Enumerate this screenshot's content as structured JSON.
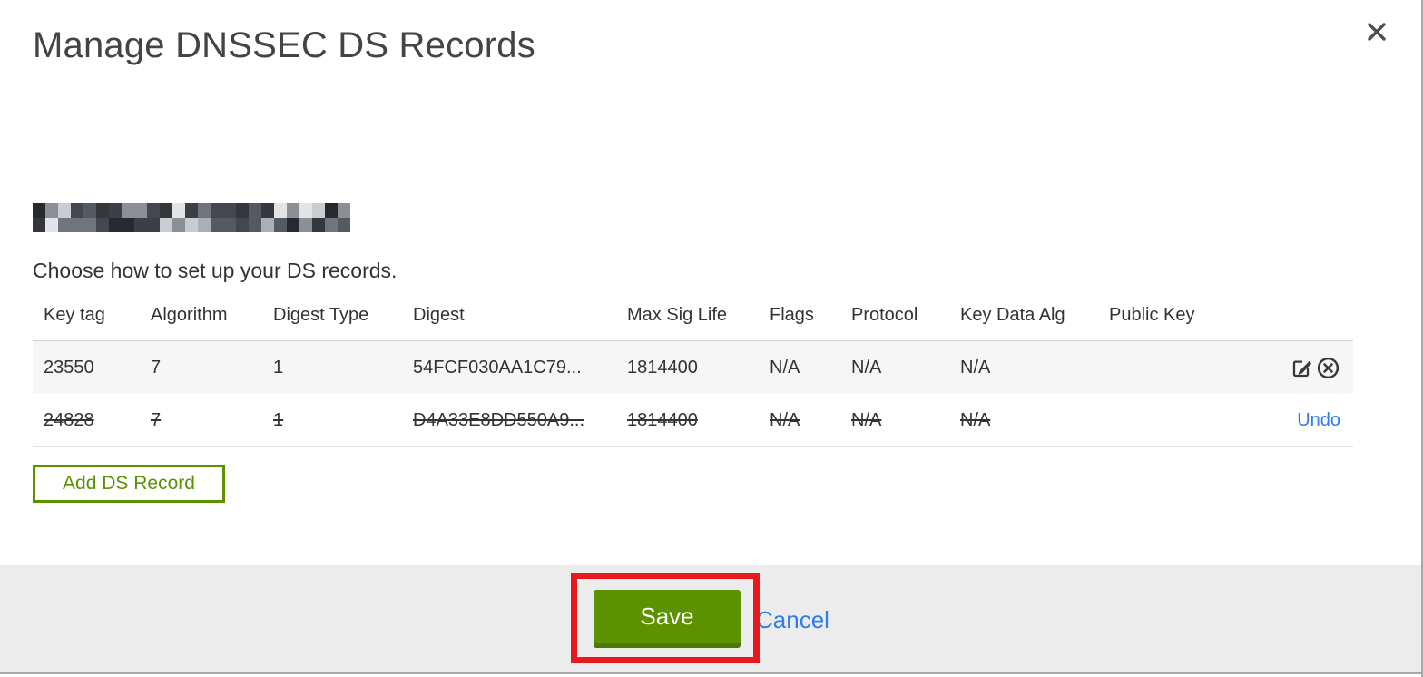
{
  "modal": {
    "title": "Manage DNSSEC DS Records",
    "intro": "Choose how to set up your DS records.",
    "domain_name_redacted": true
  },
  "table": {
    "headers": {
      "key_tag": "Key tag",
      "algorithm": "Algorithm",
      "digest_type": "Digest Type",
      "digest": "Digest",
      "max_sig_life": "Max Sig Life",
      "flags": "Flags",
      "protocol": "Protocol",
      "key_data_alg": "Key Data Alg",
      "public_key": "Public Key"
    },
    "rows": [
      {
        "key_tag": "23550",
        "algorithm": "7",
        "digest_type": "1",
        "digest": "54FCF030AA1C79...",
        "max_sig_life": "1814400",
        "flags": "N/A",
        "protocol": "N/A",
        "key_data_alg": "N/A",
        "public_key": "",
        "deleted": false
      },
      {
        "key_tag": "24828",
        "algorithm": "7",
        "digest_type": "1",
        "digest": "D4A33E8DD550A9...",
        "max_sig_life": "1814400",
        "flags": "N/A",
        "protocol": "N/A",
        "key_data_alg": "N/A",
        "public_key": "",
        "deleted": true,
        "undo_label": "Undo"
      }
    ]
  },
  "buttons": {
    "add_ds_record": "Add DS Record",
    "save": "Save",
    "cancel": "Cancel"
  },
  "icons": {
    "close": "x-cross",
    "edit": "pencil-in-square",
    "delete": "x-in-circle"
  },
  "colors": {
    "green": "#5c9100",
    "green_dark": "#4b7a02",
    "link_blue": "#2f7df0",
    "annotation_red": "#e8191d",
    "footer_bg": "#ececec",
    "row_alt_bg": "#f6f6f6"
  }
}
